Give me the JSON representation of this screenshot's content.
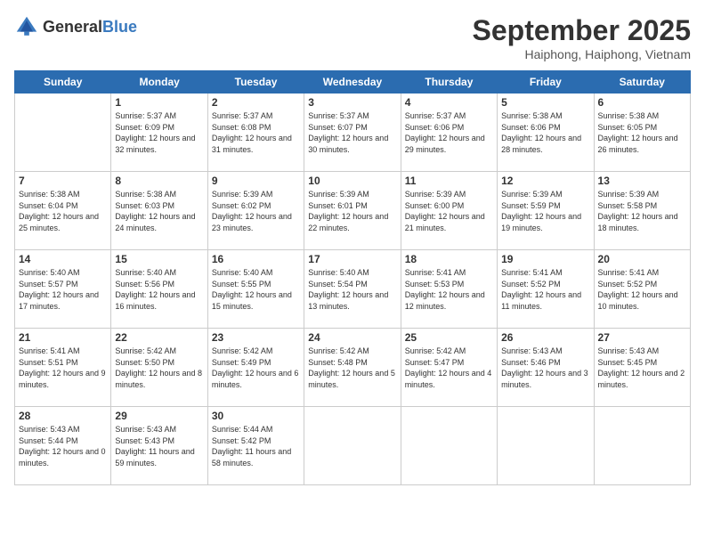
{
  "header": {
    "logo_general": "General",
    "logo_blue": "Blue",
    "month": "September 2025",
    "location": "Haiphong, Haiphong, Vietnam"
  },
  "days": [
    "Sunday",
    "Monday",
    "Tuesday",
    "Wednesday",
    "Thursday",
    "Friday",
    "Saturday"
  ],
  "weeks": [
    [
      {
        "date": "",
        "content": ""
      },
      {
        "date": "1",
        "sunrise": "Sunrise: 5:37 AM",
        "sunset": "Sunset: 6:09 PM",
        "daylight": "Daylight: 12 hours and 32 minutes."
      },
      {
        "date": "2",
        "sunrise": "Sunrise: 5:37 AM",
        "sunset": "Sunset: 6:08 PM",
        "daylight": "Daylight: 12 hours and 31 minutes."
      },
      {
        "date": "3",
        "sunrise": "Sunrise: 5:37 AM",
        "sunset": "Sunset: 6:07 PM",
        "daylight": "Daylight: 12 hours and 30 minutes."
      },
      {
        "date": "4",
        "sunrise": "Sunrise: 5:37 AM",
        "sunset": "Sunset: 6:06 PM",
        "daylight": "Daylight: 12 hours and 29 minutes."
      },
      {
        "date": "5",
        "sunrise": "Sunrise: 5:38 AM",
        "sunset": "Sunset: 6:06 PM",
        "daylight": "Daylight: 12 hours and 28 minutes."
      },
      {
        "date": "6",
        "sunrise": "Sunrise: 5:38 AM",
        "sunset": "Sunset: 6:05 PM",
        "daylight": "Daylight: 12 hours and 26 minutes."
      }
    ],
    [
      {
        "date": "7",
        "sunrise": "Sunrise: 5:38 AM",
        "sunset": "Sunset: 6:04 PM",
        "daylight": "Daylight: 12 hours and 25 minutes."
      },
      {
        "date": "8",
        "sunrise": "Sunrise: 5:38 AM",
        "sunset": "Sunset: 6:03 PM",
        "daylight": "Daylight: 12 hours and 24 minutes."
      },
      {
        "date": "9",
        "sunrise": "Sunrise: 5:39 AM",
        "sunset": "Sunset: 6:02 PM",
        "daylight": "Daylight: 12 hours and 23 minutes."
      },
      {
        "date": "10",
        "sunrise": "Sunrise: 5:39 AM",
        "sunset": "Sunset: 6:01 PM",
        "daylight": "Daylight: 12 hours and 22 minutes."
      },
      {
        "date": "11",
        "sunrise": "Sunrise: 5:39 AM",
        "sunset": "Sunset: 6:00 PM",
        "daylight": "Daylight: 12 hours and 21 minutes."
      },
      {
        "date": "12",
        "sunrise": "Sunrise: 5:39 AM",
        "sunset": "Sunset: 5:59 PM",
        "daylight": "Daylight: 12 hours and 19 minutes."
      },
      {
        "date": "13",
        "sunrise": "Sunrise: 5:39 AM",
        "sunset": "Sunset: 5:58 PM",
        "daylight": "Daylight: 12 hours and 18 minutes."
      }
    ],
    [
      {
        "date": "14",
        "sunrise": "Sunrise: 5:40 AM",
        "sunset": "Sunset: 5:57 PM",
        "daylight": "Daylight: 12 hours and 17 minutes."
      },
      {
        "date": "15",
        "sunrise": "Sunrise: 5:40 AM",
        "sunset": "Sunset: 5:56 PM",
        "daylight": "Daylight: 12 hours and 16 minutes."
      },
      {
        "date": "16",
        "sunrise": "Sunrise: 5:40 AM",
        "sunset": "Sunset: 5:55 PM",
        "daylight": "Daylight: 12 hours and 15 minutes."
      },
      {
        "date": "17",
        "sunrise": "Sunrise: 5:40 AM",
        "sunset": "Sunset: 5:54 PM",
        "daylight": "Daylight: 12 hours and 13 minutes."
      },
      {
        "date": "18",
        "sunrise": "Sunrise: 5:41 AM",
        "sunset": "Sunset: 5:53 PM",
        "daylight": "Daylight: 12 hours and 12 minutes."
      },
      {
        "date": "19",
        "sunrise": "Sunrise: 5:41 AM",
        "sunset": "Sunset: 5:52 PM",
        "daylight": "Daylight: 12 hours and 11 minutes."
      },
      {
        "date": "20",
        "sunrise": "Sunrise: 5:41 AM",
        "sunset": "Sunset: 5:52 PM",
        "daylight": "Daylight: 12 hours and 10 minutes."
      }
    ],
    [
      {
        "date": "21",
        "sunrise": "Sunrise: 5:41 AM",
        "sunset": "Sunset: 5:51 PM",
        "daylight": "Daylight: 12 hours and 9 minutes."
      },
      {
        "date": "22",
        "sunrise": "Sunrise: 5:42 AM",
        "sunset": "Sunset: 5:50 PM",
        "daylight": "Daylight: 12 hours and 8 minutes."
      },
      {
        "date": "23",
        "sunrise": "Sunrise: 5:42 AM",
        "sunset": "Sunset: 5:49 PM",
        "daylight": "Daylight: 12 hours and 6 minutes."
      },
      {
        "date": "24",
        "sunrise": "Sunrise: 5:42 AM",
        "sunset": "Sunset: 5:48 PM",
        "daylight": "Daylight: 12 hours and 5 minutes."
      },
      {
        "date": "25",
        "sunrise": "Sunrise: 5:42 AM",
        "sunset": "Sunset: 5:47 PM",
        "daylight": "Daylight: 12 hours and 4 minutes."
      },
      {
        "date": "26",
        "sunrise": "Sunrise: 5:43 AM",
        "sunset": "Sunset: 5:46 PM",
        "daylight": "Daylight: 12 hours and 3 minutes."
      },
      {
        "date": "27",
        "sunrise": "Sunrise: 5:43 AM",
        "sunset": "Sunset: 5:45 PM",
        "daylight": "Daylight: 12 hours and 2 minutes."
      }
    ],
    [
      {
        "date": "28",
        "sunrise": "Sunrise: 5:43 AM",
        "sunset": "Sunset: 5:44 PM",
        "daylight": "Daylight: 12 hours and 0 minutes."
      },
      {
        "date": "29",
        "sunrise": "Sunrise: 5:43 AM",
        "sunset": "Sunset: 5:43 PM",
        "daylight": "Daylight: 11 hours and 59 minutes."
      },
      {
        "date": "30",
        "sunrise": "Sunrise: 5:44 AM",
        "sunset": "Sunset: 5:42 PM",
        "daylight": "Daylight: 11 hours and 58 minutes."
      },
      {
        "date": "",
        "content": ""
      },
      {
        "date": "",
        "content": ""
      },
      {
        "date": "",
        "content": ""
      },
      {
        "date": "",
        "content": ""
      }
    ]
  ]
}
